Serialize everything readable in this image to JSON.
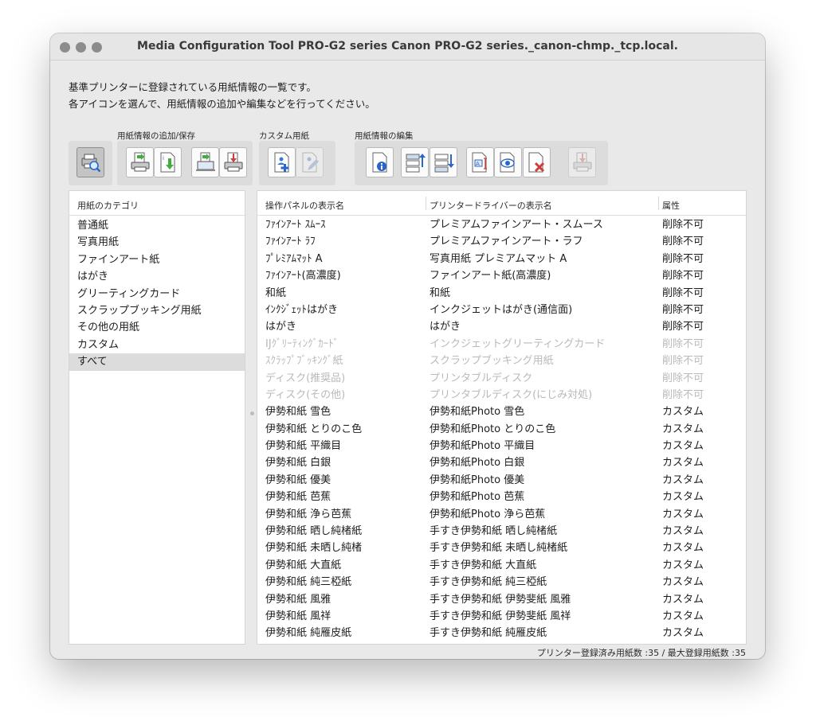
{
  "window": {
    "title": "Media Configuration Tool PRO-G2 series Canon PRO-G2 series._canon-chmp._tcp.local."
  },
  "description": {
    "line1": "基準プリンターに登録されている用紙情報の一覧です。",
    "line2": "各アイコンを選んで、用紙情報の追加や編集などを行ってください。"
  },
  "toolbar": {
    "group_add_save": "用紙情報の追加/保存",
    "group_custom": "カスタム用紙",
    "group_edit": "用紙情報の編集"
  },
  "categories": {
    "header": "用紙のカテゴリ",
    "items": [
      "普通紙",
      "写真用紙",
      "ファインアート紙",
      "はがき",
      "グリーティングカード",
      "スクラップブッキング用紙",
      "その他の用紙",
      "カスタム",
      "すべて"
    ],
    "selected": "すべて"
  },
  "table": {
    "headers": {
      "panel": "操作パネルの表示名",
      "driver": "プリンタードライバーの表示名",
      "attr": "属性"
    },
    "rows": [
      [
        "ﾌｧｲﾝｱｰﾄ ｽﾑｰｽ",
        "プレミアムファインアート・スムース",
        "削除不可"
      ],
      [
        "ﾌｧｲﾝｱｰﾄ ﾗﾌ",
        "プレミアムファインアート・ラフ",
        "削除不可"
      ],
      [
        "ﾌﾟﾚﾐｱﾑﾏｯﾄ A",
        "写真用紙 プレミアムマット A",
        "削除不可"
      ],
      [
        "ﾌｧｲﾝｱｰﾄ(高濃度)",
        "ファインアート紙(高濃度)",
        "削除不可"
      ],
      [
        "和紙",
        "和紙",
        "削除不可"
      ],
      [
        "ｲﾝｸｼﾞｪｯﾄはがき",
        "インクジェットはがき(通信面)",
        "削除不可"
      ],
      [
        "はがき",
        "はがき",
        "削除不可"
      ],
      [
        "IJｸﾞﾘｰﾃｨﾝｸﾞｶｰﾄﾞ",
        "インクジェットグリーティングカード",
        "削除不可"
      ],
      [
        "ｽｸﾗｯﾌﾟﾌﾞｯｷﾝｸﾞ紙",
        "スクラップブッキング用紙",
        "削除不可"
      ],
      [
        "ディスク(推奨品)",
        "プリンタブルディスク",
        "削除不可"
      ],
      [
        "ディスク(その他)",
        "プリンタブルディスク(にじみ対処)",
        "削除不可"
      ],
      [
        "伊勢和紙 雪色",
        "伊勢和紙Photo 雪色",
        "カスタム"
      ],
      [
        "伊勢和紙 とりのこ色",
        "伊勢和紙Photo とりのこ色",
        "カスタム"
      ],
      [
        "伊勢和紙 平織目",
        "伊勢和紙Photo 平織目",
        "カスタム"
      ],
      [
        "伊勢和紙 白銀",
        "伊勢和紙Photo 白銀",
        "カスタム"
      ],
      [
        "伊勢和紙 優美",
        "伊勢和紙Photo 優美",
        "カスタム"
      ],
      [
        "伊勢和紙 芭蕉",
        "伊勢和紙Photo 芭蕉",
        "カスタム"
      ],
      [
        "伊勢和紙 浄ら芭蕉",
        "伊勢和紙Photo 浄ら芭蕉",
        "カスタム"
      ],
      [
        "伊勢和紙 晒し純楮紙",
        "手すき伊勢和紙 晒し純楮紙",
        "カスタム"
      ],
      [
        "伊勢和紙 未晒し純楮",
        "手すき伊勢和紙 未晒し純楮紙",
        "カスタム"
      ],
      [
        "伊勢和紙 大直紙",
        "手すき伊勢和紙 大直紙",
        "カスタム"
      ],
      [
        "伊勢和紙 純三椏紙",
        "手すき伊勢和紙 純三椏紙",
        "カスタム"
      ],
      [
        "伊勢和紙 風雅",
        "手すき伊勢和紙 伊勢斐紙 風雅",
        "カスタム"
      ],
      [
        "伊勢和紙 風祥",
        "手すき伊勢和紙 伊勢斐紙 風祥",
        "カスタム"
      ],
      [
        "伊勢和紙 純雁皮紙",
        "手すき伊勢和紙 純雁皮紙",
        "カスタム"
      ]
    ],
    "dimmed_rows": [
      7,
      8,
      9,
      10
    ]
  },
  "status": {
    "text": "プリンター登録済み用紙数 :35 / 最大登録用紙数 :35"
  }
}
